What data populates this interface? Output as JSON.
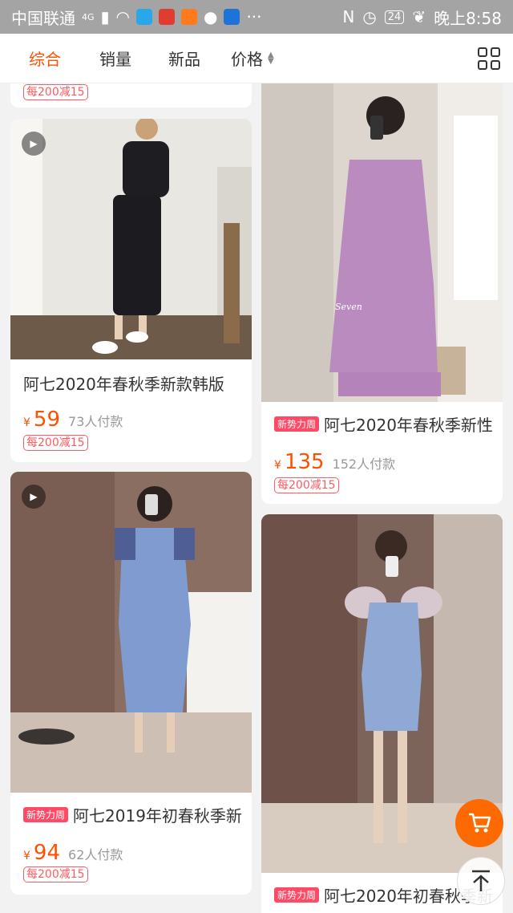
{
  "status_bar": {
    "carrier": "中国联通",
    "network": "4G",
    "battery": "24",
    "time": "晚上8:58"
  },
  "tabs": [
    {
      "label": "综合",
      "active": true
    },
    {
      "label": "销量"
    },
    {
      "label": "新品"
    },
    {
      "label": "价格"
    }
  ],
  "colors": {
    "accent": "#ff5000",
    "promo": "#ff5a5f",
    "badge": "#ff4a66",
    "fab": "#ff6a00"
  },
  "partial_promo": "每200减15",
  "products": [
    {
      "title": "阿七2020年春秋季新款韩版",
      "price": "59",
      "sold": "73人付款",
      "promo": "每200减15",
      "has_video": true,
      "badge": ""
    },
    {
      "title": "阿七2020年春秋季新性",
      "price": "135",
      "sold": "152人付款",
      "promo": "每200减15",
      "has_video": false,
      "badge": "新势力周",
      "watermark": "Seven"
    },
    {
      "title": "阿七2019年初春秋季新",
      "price": "94",
      "sold": "62人付款",
      "promo": "每200减15",
      "has_video": true,
      "badge": "新势力周"
    },
    {
      "title": "阿七2020年初春秋季新",
      "price": "",
      "sold": "",
      "promo": "",
      "has_video": false,
      "badge": "新势力周"
    }
  ],
  "currency": "¥",
  "icons": {
    "play": "play-icon",
    "cart": "cart-icon",
    "back_to_top": "arrow-up-icon",
    "grid": "grid-view-icon"
  }
}
